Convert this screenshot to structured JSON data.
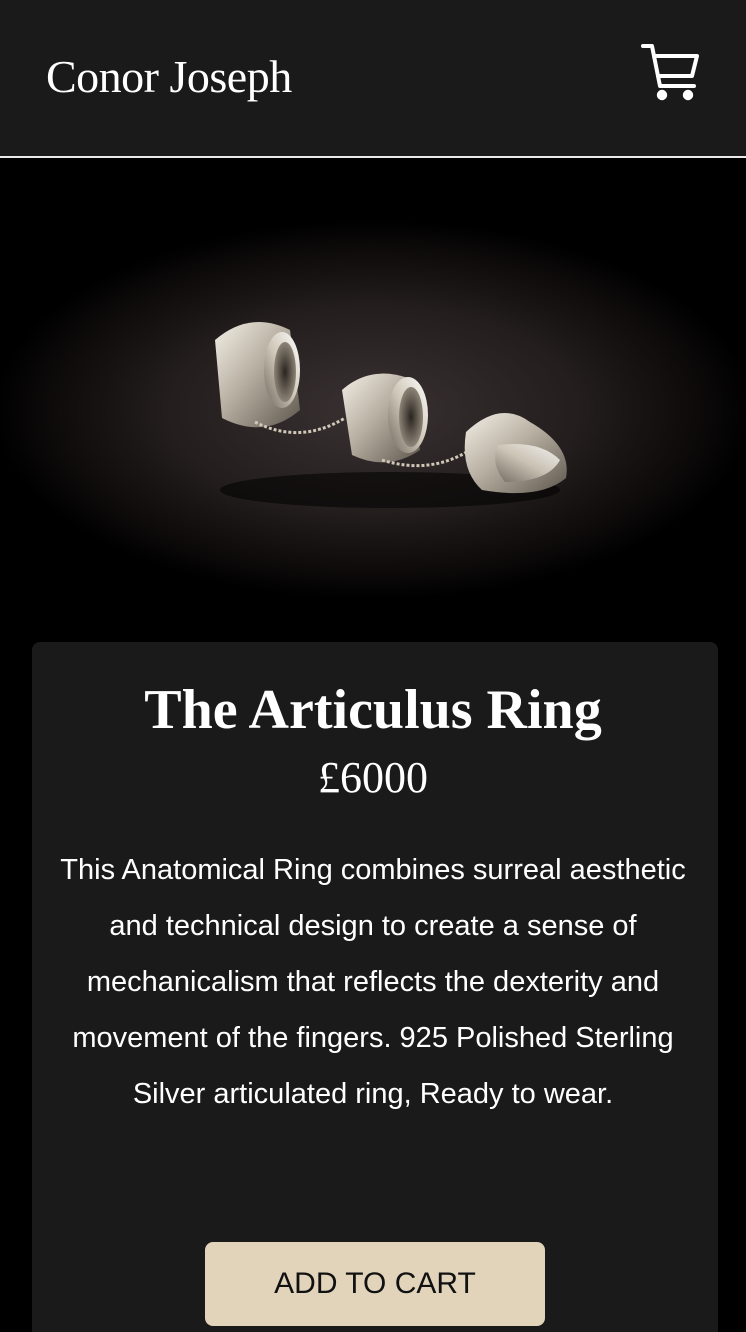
{
  "header": {
    "brand": "Conor Joseph",
    "cart_icon": "shopping-cart-icon"
  },
  "product": {
    "image_alt": "The Articulus Ring",
    "title": "The Articulus Ring",
    "price": "£6000",
    "description": "This Anatomical Ring combines surreal aesthetic and technical design to create a sense of mechanicalism that reflects the dexterity and movement of the fingers. 925 Polished Sterling Silver articulated ring, Ready to wear.",
    "add_to_cart_label": "ADD TO CART"
  },
  "colors": {
    "header_bg": "#1b1a1b",
    "page_bg": "#000000",
    "card_bg": "#1b1a1b",
    "button_bg": "#e1d4bb",
    "text": "#ffffff"
  }
}
